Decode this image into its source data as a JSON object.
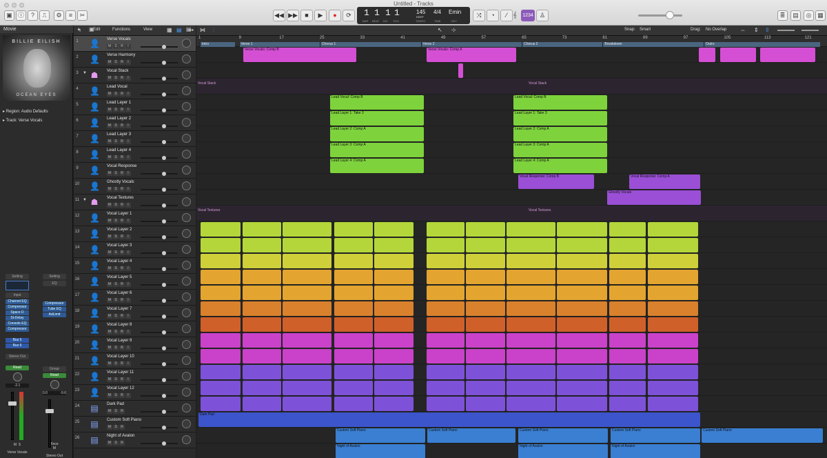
{
  "window": {
    "title": "Untitled - Tracks"
  },
  "transport": {
    "bar": "1",
    "beat": "1",
    "div": "1",
    "tick": "1",
    "tempo": "145",
    "tempo_mode": "KEEP",
    "sig": "4/4",
    "key": "Emin",
    "bar_lbl": "BAR",
    "beat_lbl": "BEAT",
    "div_lbl": "DIV",
    "tick_lbl": "TICK",
    "tempo_lbl": "TEMPO",
    "time_lbl": "TIME",
    "key_lbl": "KEY",
    "count_in": "1234"
  },
  "menus": {
    "edit": "Edit",
    "functions": "Functions",
    "view": "View",
    "snap_label": "Snap:",
    "snap": "Smart",
    "drag_label": "Drag:",
    "drag": "No Overlap"
  },
  "inspector": {
    "header": "Movie",
    "art_top": "BILLIE EILISH",
    "art_bottom": "OCEAN EYES",
    "region": "Region: Audio Defaults",
    "track_label": "Track:",
    "track_value": "Verse Vocals",
    "setting": "Setting",
    "eq": "EQ",
    "input": "Input",
    "plugins": [
      "Channel EQ",
      "Compressor",
      "Space D",
      "St-Delay",
      "Console EQ",
      "Compressor"
    ],
    "plugins_b": [
      "Compressor",
      "Tube EQ",
      "AdLimit"
    ],
    "sends": [
      "Bus 5",
      "Bus 6"
    ],
    "out": "Stereo Out",
    "group": "Group",
    "read": "Read",
    "vol_a": "-2.1",
    "vol_b": "0.0",
    "vol_c": "-9.6",
    "bnce": "Bnce",
    "name_a": "Verse Vocals",
    "name_b": "Stereo Out",
    "m": "M",
    "s": "S"
  },
  "markers": [
    {
      "label": "Intro"
    },
    {
      "label": "Verse 1"
    },
    {
      "label": "Chorus 1"
    },
    {
      "label": "Verse 2"
    },
    {
      "label": "Chorus 2"
    },
    {
      "label": "Breakdown"
    },
    {
      "label": "Outro"
    }
  ],
  "bars": [
    "1",
    "9",
    "17",
    "25",
    "33",
    "41",
    "49",
    "57",
    "65",
    "73",
    "81",
    "89",
    "97",
    "105",
    "113",
    "121"
  ],
  "tracks": [
    {
      "num": "1",
      "name": "Verse Vocals"
    },
    {
      "num": "2",
      "name": "Verse Harmony"
    },
    {
      "num": "3",
      "name": "Vocal Stack"
    },
    {
      "num": "4",
      "name": "Lead Vocal"
    },
    {
      "num": "5",
      "name": "Lead Layer 1"
    },
    {
      "num": "6",
      "name": "Lead Layer 2"
    },
    {
      "num": "7",
      "name": "Lead Layer 3"
    },
    {
      "num": "8",
      "name": "Lead Layer 4"
    },
    {
      "num": "9",
      "name": "Vocal Response"
    },
    {
      "num": "10",
      "name": "Ghostly Vocals"
    },
    {
      "num": "11",
      "name": "Vocal Textures"
    },
    {
      "num": "12",
      "name": "Vocal Layer 1"
    },
    {
      "num": "13",
      "name": "Vocal Layer 2"
    },
    {
      "num": "14",
      "name": "Vocal Layer 3"
    },
    {
      "num": "15",
      "name": "Vocal Layer 4"
    },
    {
      "num": "16",
      "name": "Vocal Layer 5"
    },
    {
      "num": "17",
      "name": "Vocal Layer 6"
    },
    {
      "num": "18",
      "name": "Vocal Layer 7"
    },
    {
      "num": "19",
      "name": "Vocal Layer 8"
    },
    {
      "num": "20",
      "name": "Vocal Layer 9"
    },
    {
      "num": "21",
      "name": "Vocal Layer 10"
    },
    {
      "num": "22",
      "name": "Vocal Layer 11"
    },
    {
      "num": "23",
      "name": "Vocal Layer 12"
    },
    {
      "num": "24",
      "name": "Dark Pad"
    },
    {
      "num": "25",
      "name": "Custom Soft Piano"
    },
    {
      "num": "26",
      "name": "Night of Avalon"
    }
  ],
  "regions": {
    "verse_vocals": "Verse Vocals: Comp B",
    "verse_vocals_a": "Verse Vocals: Comp A",
    "vocal_stack": "Vocal Stack",
    "lead_vocal": "Lead Vocal: Comp B",
    "lead_l1": "Lead Layer 1: Take 3",
    "lead_l2": "Lead Layer 2: Comp A",
    "lead_l3": "Lead Layer 3: Comp A",
    "lead_l4": "Lead Layer 4: Comp A",
    "vresp_b": "Vocal Response: Comp B",
    "vresp_a": "Vocal Response: Comp A",
    "ghost": "Ghostly Vocals",
    "textures": "Vocal Textures",
    "dark_pad": "Dark Pad",
    "piano": "Custom Soft Piano",
    "avalon": "Night of Avalon"
  },
  "colors": {
    "magenta": "#d44fd4",
    "green": "#7ed33c",
    "lime": "#b4d63a",
    "yellow": "#cfcf3a",
    "orange": "#e3a52f",
    "burnt": "#d9812c",
    "red": "#d0602a",
    "pink": "#c942c9",
    "purple": "#9a4fd6",
    "violet": "#7d52d8",
    "blue": "#3c55cc",
    "lightblue": "#3a7fd2"
  }
}
